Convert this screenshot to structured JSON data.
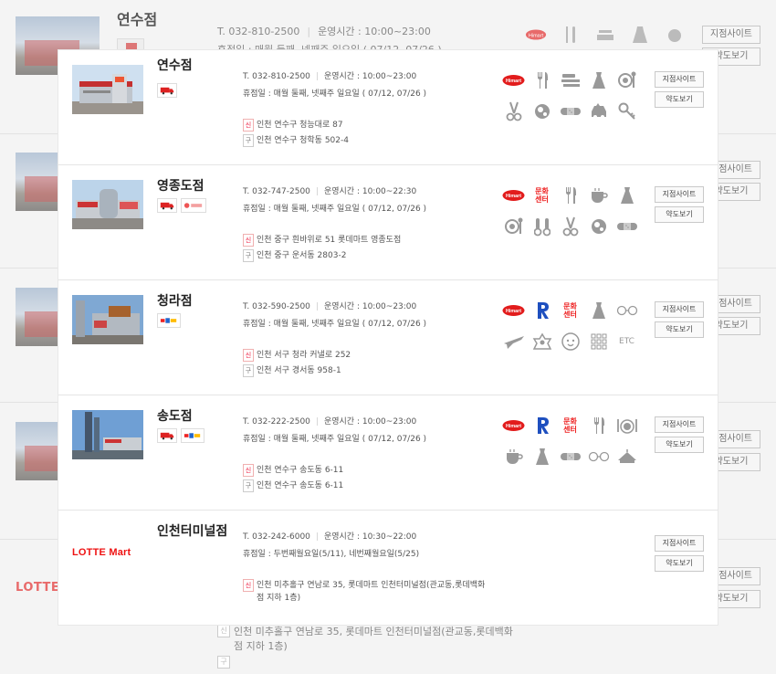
{
  "background": {
    "title": "연수점",
    "phone": "T. 032-810-2500",
    "hours": "운영시간 : 10:00~23:00",
    "closed": "휴점일 : 매월 둘째, 넷째주 일요일 ( 07/12, 07/26 )",
    "site_label": "지점사이트",
    "map_label": "약도보기",
    "lotte_text": "LOTTE",
    "addr_new_badge": "신",
    "addr_old_badge": "구",
    "addr_new": "인천 미추홀구 연남로 35, 롯데마트 인천터미널점(관교동,롯데백화점 지하 1층)",
    "addr_new_line1": "인천 미추홀구 연남로 35, 롯데마트 인천터미널점(관교동,롯데백화",
    "addr_new_line2": "점 지하 1층)"
  },
  "labels": {
    "site": "지점사이트",
    "map": "약도보기",
    "new_badge": "신",
    "old_badge": "구",
    "culture": "문화센터",
    "etc": "ETC"
  },
  "stores": [
    {
      "name": "연수점",
      "phone": "T. 032-810-2500",
      "hours": "운영시간 : 10:00~23:00",
      "closed": "휴점일 : 매월 둘째, 넷째주 일요일 ( 07/12, 07/26 )",
      "addr_new": "인천 연수구 청능대로 87",
      "addr_old": "인천 연수구 청학동 502-4",
      "icons": [
        "himart-icon",
        "tableware-icon",
        "bedding-icon",
        "clothing-icon",
        "food-court-icon",
        "scissors-icon",
        "optical-icon",
        "bandage-icon",
        "car-service-icon",
        "key-repair-icon"
      ]
    },
    {
      "name": "영종도점",
      "phone": "T. 032-747-2500",
      "hours": "운영시간 : 10:00~22:30",
      "closed": "휴점일 : 매월 둘째, 넷째주 일요일 ( 07/12, 07/26 )",
      "addr_new": "인천 중구 흰바위로 51 롯데마트 영종도점",
      "addr_old": "인천 중구 운서동 2803-2",
      "icons": [
        "himart-icon",
        "culture-center-icon",
        "tableware-icon",
        "cafe-icon",
        "clothing-icon",
        "food-court-icon",
        "kids-icon",
        "scissors-icon",
        "optical-icon",
        "bandage-icon"
      ]
    },
    {
      "name": "청라점",
      "phone": "T. 032-590-2500",
      "hours": "운영시간 : 10:00~23:00",
      "closed": "휴점일 : 매월 둘째, 넷째주 일요일 ( 07/12, 07/26 )",
      "addr_new": "인천 서구 청라 커낼로 252",
      "addr_old": "인천 서구 경서동 958-1",
      "icons": [
        "himart-icon",
        "toysrus-icon",
        "culture-center-icon",
        "clothing-icon",
        "glasses-icon",
        "airplane-icon",
        "pharmacy-icon",
        "baby-icon",
        "grid-icon",
        "etc-icon"
      ]
    },
    {
      "name": "송도점",
      "phone": "T. 032-222-2500",
      "hours": "운영시간 : 10:00~23:00",
      "closed": "휴점일 : 매월 둘째, 넷째주 일요일 ( 07/12, 07/26 )",
      "addr_new": "인천 연수구 송도동 6-11",
      "addr_old": "인천 연수구 송도동 6-11",
      "icons": [
        "himart-icon",
        "toysrus-icon",
        "culture-center-icon",
        "tableware-icon",
        "dining-icon",
        "cafe-icon",
        "clothing-icon",
        "bandage-icon",
        "glasses-icon",
        "bakery-icon"
      ]
    },
    {
      "name": "인천터미널점",
      "phone": "T. 032-242-6000",
      "hours": "운영시간 : 10:30~22:00",
      "closed": "휴점일 : 두번째월요일(5/11), 네번째월요일(5/25)",
      "addr_new_line1": "인천 미추홀구 연남로 35, 롯데마트 인천터미널점(관교동,롯데백화",
      "addr_new_line2": "점 지하 1층)",
      "logo_text_a": "LOTTE",
      "logo_text_b": "Mart",
      "icons": []
    }
  ],
  "colors": {
    "accent": "#e21c1c",
    "text": "#555555",
    "border": "#c9c9c9"
  }
}
